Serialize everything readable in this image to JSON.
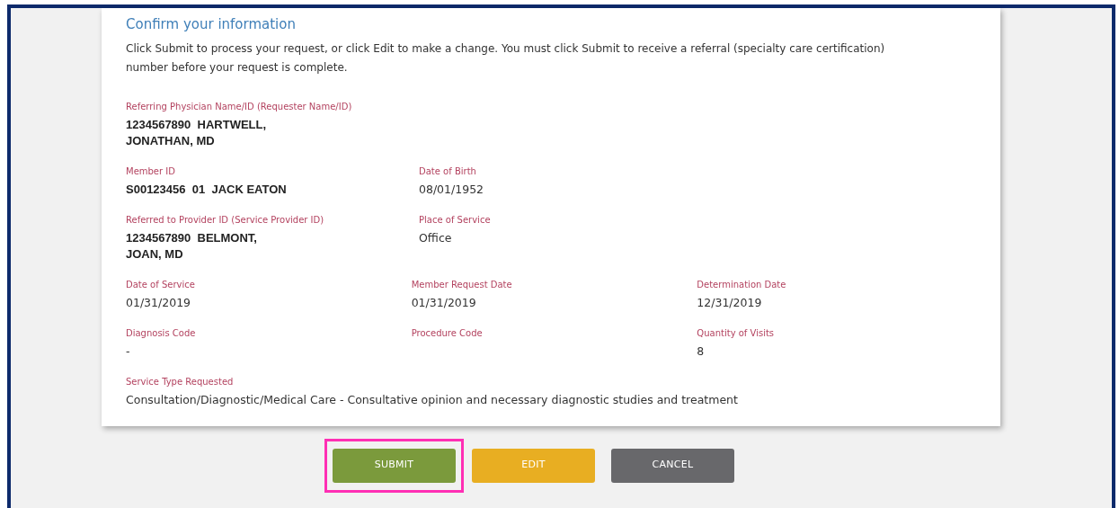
{
  "title": "Confirm your information",
  "intro": "Click Submit to process your request, or click Edit to make a change. You must click Submit to receive a referral (specialty care certification) number before your request is complete.",
  "rows": [
    {
      "fields": [
        {
          "label": "Referring Physician Name/ID (Requester Name/ID)",
          "value": "1234567890  HARTWELL, JONATHAN, MD",
          "bold": true
        }
      ]
    },
    {
      "fields": [
        {
          "label": "Member ID",
          "value": "S00123456  01  JACK EATON",
          "bold": true
        },
        {
          "label": "Date of Birth",
          "value": "08/01/1952",
          "bold": false
        }
      ]
    },
    {
      "fields": [
        {
          "label": "Referred to Provider ID (Service Provider ID)",
          "value": "1234567890  BELMONT, JOAN, MD",
          "bold": true
        },
        {
          "label": "Place of Service",
          "value": "Office",
          "bold": false
        }
      ]
    },
    {
      "fields": [
        {
          "label": "Date of Service",
          "value": "01/31/2019",
          "bold": false
        },
        {
          "label": "Member Request Date",
          "value": "01/31/2019",
          "bold": false
        },
        {
          "label": "Determination Date",
          "value": "12/31/2019",
          "bold": false
        }
      ]
    },
    {
      "fields": [
        {
          "label": "Diagnosis Code",
          "value": "-",
          "bold": false
        },
        {
          "label": "Procedure Code"
        },
        {
          "label": "Quantity of Visits",
          "value": "8",
          "bold": false
        }
      ]
    },
    {
      "wide": true,
      "fields": [
        {
          "label": "Service Type Requested",
          "value": "Consultation/Diagnostic/Medical Care - Consultative opinion and necessary diagnostic studies and treatment",
          "bold": false
        }
      ]
    }
  ],
  "buttons": [
    {
      "label": "SUBMIT",
      "color": "#7b9a3c",
      "highlighted": true
    },
    {
      "label": "EDIT",
      "color": "#e8ae22",
      "highlighted": false
    },
    {
      "label": "CANCEL",
      "color": "#68686b",
      "highlighted": false
    }
  ]
}
